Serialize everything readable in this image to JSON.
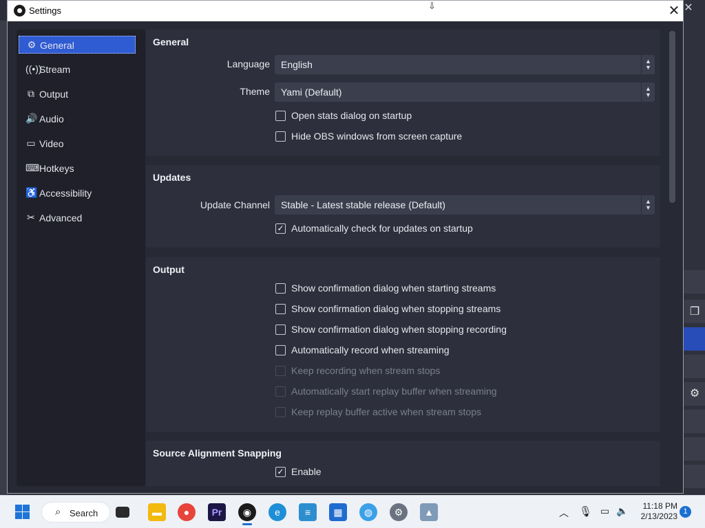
{
  "window": {
    "title": "Settings"
  },
  "sidebar": {
    "items": [
      {
        "label": "General",
        "icon": "gear-icon",
        "active": true
      },
      {
        "label": "Stream",
        "icon": "broadcast-icon",
        "active": false
      },
      {
        "label": "Output",
        "icon": "output-icon",
        "active": false
      },
      {
        "label": "Audio",
        "icon": "speaker-icon",
        "active": false
      },
      {
        "label": "Video",
        "icon": "monitor-icon",
        "active": false
      },
      {
        "label": "Hotkeys",
        "icon": "keyboard-icon",
        "active": false
      },
      {
        "label": "Accessibility",
        "icon": "accessibility-icon",
        "active": false
      },
      {
        "label": "Advanced",
        "icon": "tools-icon",
        "active": false
      }
    ]
  },
  "general": {
    "title": "General",
    "language_label": "Language",
    "language_value": "English",
    "theme_label": "Theme",
    "theme_value": "Yami (Default)",
    "open_stats": {
      "label": "Open stats dialog on startup",
      "checked": false
    },
    "hide_obs": {
      "label": "Hide OBS windows from screen capture",
      "checked": false
    }
  },
  "updates": {
    "title": "Updates",
    "channel_label": "Update Channel",
    "channel_value": "Stable - Latest stable release (Default)",
    "auto_check": {
      "label": "Automatically check for updates on startup",
      "checked": true
    }
  },
  "output": {
    "title": "Output",
    "options": [
      {
        "label": "Show confirmation dialog when starting streams",
        "checked": false,
        "disabled": false
      },
      {
        "label": "Show confirmation dialog when stopping streams",
        "checked": false,
        "disabled": false
      },
      {
        "label": "Show confirmation dialog when stopping recording",
        "checked": false,
        "disabled": false
      },
      {
        "label": "Automatically record when streaming",
        "checked": false,
        "disabled": false
      },
      {
        "label": "Keep recording when stream stops",
        "checked": false,
        "disabled": true
      },
      {
        "label": "Automatically start replay buffer when streaming",
        "checked": false,
        "disabled": true
      },
      {
        "label": "Keep replay buffer active when stream stops",
        "checked": false,
        "disabled": true
      }
    ]
  },
  "snapping": {
    "title": "Source Alignment Snapping",
    "enable": {
      "label": "Enable",
      "checked": true
    }
  },
  "taskbar": {
    "search_label": "Search",
    "time": "11:18 PM",
    "date": "2/13/2023",
    "notification_count": "1",
    "apps": [
      "file-explorer-icon",
      "chrome-icon",
      "premiere-icon",
      "obs-icon",
      "edge-icon",
      "notepad-icon",
      "store-icon",
      "browser-icon",
      "settings-icon",
      "photos-icon"
    ]
  },
  "colors": {
    "accent": "#2f5bd3",
    "panel": "#2d303c",
    "background": "#272934"
  }
}
